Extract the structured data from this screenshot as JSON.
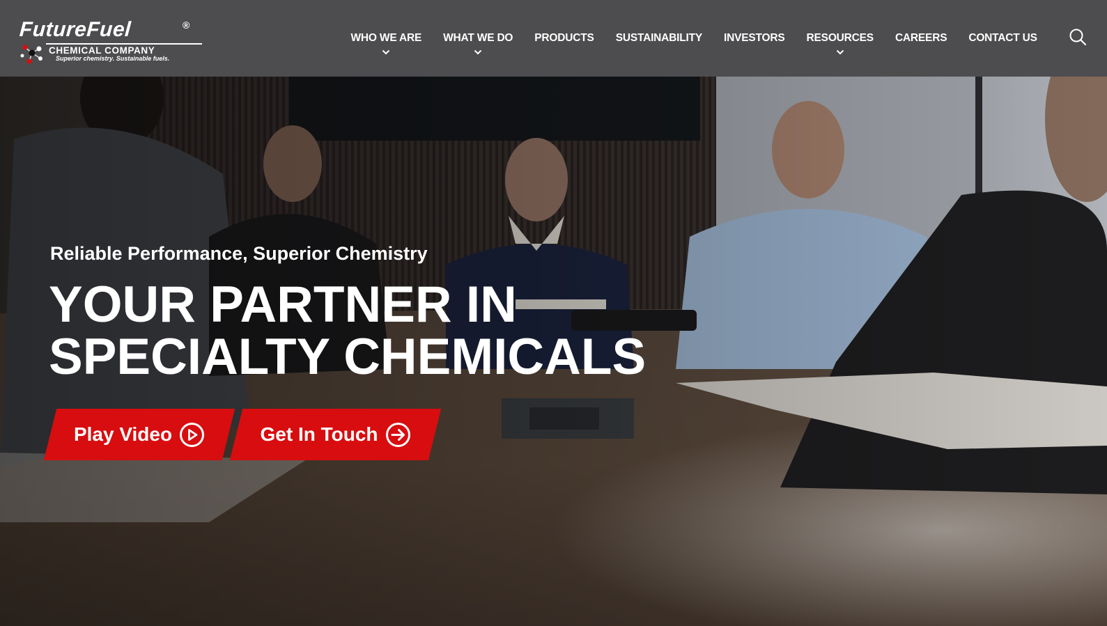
{
  "brand": {
    "name": "FutureFuel",
    "registered": "®",
    "company": "CHEMICAL COMPANY",
    "tagline": "Superior chemistry.  Sustainable fuels."
  },
  "nav": {
    "items": [
      {
        "label": "WHO WE ARE",
        "has_dropdown": true
      },
      {
        "label": "WHAT WE DO",
        "has_dropdown": true
      },
      {
        "label": "PRODUCTS",
        "has_dropdown": false
      },
      {
        "label": "SUSTAINABILITY",
        "has_dropdown": false
      },
      {
        "label": "INVESTORS",
        "has_dropdown": false
      },
      {
        "label": "RESOURCES",
        "has_dropdown": true
      },
      {
        "label": "CAREERS",
        "has_dropdown": false
      },
      {
        "label": "CONTACT US",
        "has_dropdown": false
      }
    ],
    "search_icon": "search-icon"
  },
  "hero": {
    "eyebrow": "Reliable Performance, Superior Chemistry",
    "headline_line1": "YOUR PARTNER IN",
    "headline_line2": "SPECIALTY CHEMICALS",
    "cta_play": {
      "label": "Play Video",
      "icon": "play-circle-icon"
    },
    "cta_touch": {
      "label": "Get In Touch",
      "icon": "arrow-right-circle-icon"
    }
  },
  "colors": {
    "header_bg": "#4d4d4f",
    "accent_red": "#d80d0f",
    "text": "#ffffff"
  }
}
